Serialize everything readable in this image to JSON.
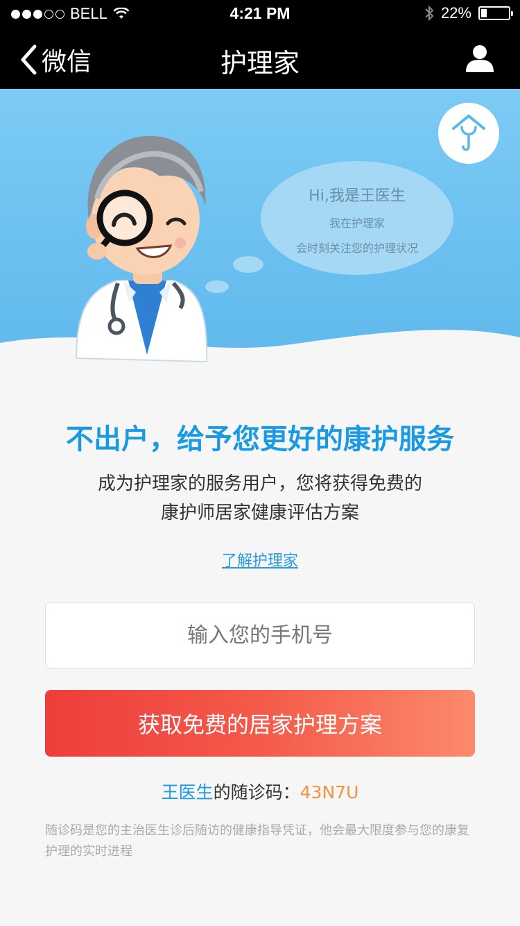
{
  "status_bar": {
    "carrier": "BELL",
    "signal_dots_filled": 3,
    "signal_dots_total": 5,
    "time": "4:21 PM",
    "battery_percent": "22%",
    "battery_level": 0.22
  },
  "nav": {
    "back_label": "微信",
    "title": "护理家",
    "user_icon": "user-icon"
  },
  "hero": {
    "bubble_title": "Hi,我是王医生",
    "bubble_line1": "我在护理家",
    "bubble_line2": "会时刻关注您的护理状况",
    "logo_icon": "house-stethoscope-icon"
  },
  "content": {
    "headline": "不出户，给予您更好的康护服务",
    "sub_line1": "成为护理家的服务用户，您将获得免费的",
    "sub_line2": "康护师居家健康评估方案",
    "learn_link": "了解护理家"
  },
  "form": {
    "phone_placeholder": "输入您的手机号",
    "phone_value": "",
    "cta_label": "获取免费的居家护理方案"
  },
  "code": {
    "doctor_name": "王医生",
    "label": "的随诊码：",
    "value": "43N7U"
  },
  "note": "随诊码是您的主治医生诊后随访的健康指导凭证，他会最大限度参与您的康复护理的实时进程",
  "colors": {
    "accent_blue": "#1b9ae4",
    "code_orange": "#f5913e",
    "cta_start": "#ee3d3c",
    "cta_end": "#fc8a6c",
    "hero_blue": "#7ccbf5"
  }
}
